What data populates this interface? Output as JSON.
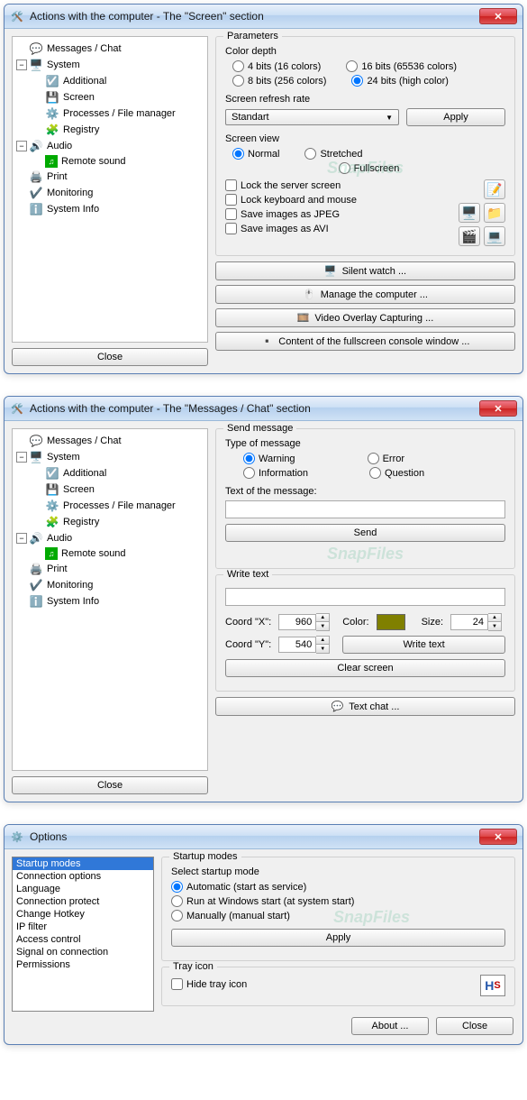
{
  "tree": {
    "items": [
      "Messages / Chat",
      "System",
      "Additional",
      "Screen",
      "Processes / File manager",
      "Registry",
      "Audio",
      "Remote sound",
      "Print",
      "Monitoring",
      "System Info"
    ]
  },
  "win1": {
    "title": "Actions with the computer - The \"Screen\" section",
    "close_btn": "Close",
    "parameters_label": "Parameters",
    "color_depth_label": "Color depth",
    "color_4": "4 bits (16 colors)",
    "color_8": "8 bits (256 colors)",
    "color_16": "16 bits (65536 colors)",
    "color_24": "24 bits (high color)",
    "refresh_label": "Screen refresh rate",
    "refresh_value": "Standart",
    "apply_label": "Apply",
    "view_label": "Screen view",
    "view_normal": "Normal",
    "view_stretched": "Stretched",
    "view_fullscreen": "Fullscreen",
    "lock_screen": "Lock the server screen",
    "lock_kbd": "Lock keyboard and mouse",
    "save_jpeg": "Save images as JPEG",
    "save_avi": "Save images as AVI",
    "silent_watch": "Silent watch ...",
    "manage": "Manage the computer ...",
    "video_overlay": "Video Overlay Capturing ...",
    "fullscreen_console": "Content of the fullscreen console window ..."
  },
  "win2": {
    "title": "Actions with the computer - The \"Messages / Chat\" section",
    "close_btn": "Close",
    "send_message_label": "Send message",
    "type_label": "Type of message",
    "type_warning": "Warning",
    "type_error": "Error",
    "type_information": "Information",
    "type_question": "Question",
    "text_label": "Text of the message:",
    "send_btn": "Send",
    "write_text_label": "Write text",
    "coord_x_label": "Coord \"X\":",
    "coord_y_label": "Coord \"Y\":",
    "coord_x_value": "960",
    "coord_y_value": "540",
    "color_label": "Color:",
    "color_value": "#808000",
    "size_label": "Size:",
    "size_value": "24",
    "write_text_btn": "Write text",
    "clear_btn": "Clear screen",
    "text_chat_btn": "Text chat ..."
  },
  "win3": {
    "title": "Options",
    "list_items": [
      "Startup modes",
      "Connection options",
      "Language",
      "Connection protect",
      "Change Hotkey",
      "IP filter",
      "Access control",
      "Signal on connection",
      "Permissions"
    ],
    "startup_modes_label": "Startup modes",
    "select_mode_label": "Select startup mode",
    "mode_auto": "Automatic (start as service)",
    "mode_winstart": "Run at Windows start (at system start)",
    "mode_manual": "Manually (manual start)",
    "apply_btn": "Apply",
    "tray_label": "Tray icon",
    "hide_tray": "Hide tray icon",
    "about_btn": "About ...",
    "close_btn": "Close"
  },
  "watermark": "SnapFiles"
}
